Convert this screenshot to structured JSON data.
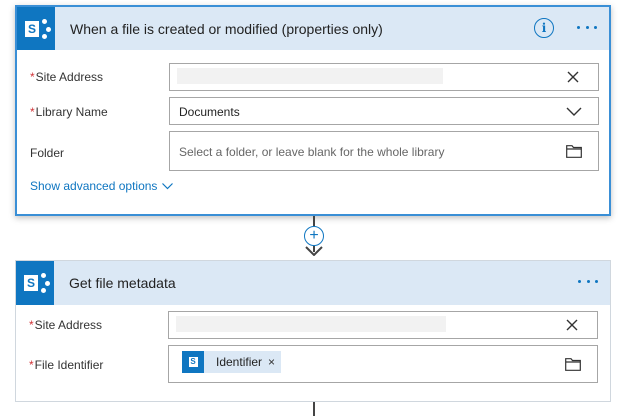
{
  "trigger": {
    "title": "When a file is created or modified (properties only)",
    "logo_letter": "S",
    "info_glyph": "i",
    "fields": {
      "site_address": {
        "label": "Site Address",
        "required": "*"
      },
      "library_name": {
        "label": "Library Name",
        "required": "*",
        "value": "Documents"
      },
      "folder": {
        "label": "Folder",
        "placeholder": "Select a folder, or leave blank for the whole library"
      }
    },
    "advanced_options": "Show advanced options"
  },
  "connector": {
    "plus_glyph": "+"
  },
  "action": {
    "title": "Get file metadata",
    "logo_letter": "S",
    "fields": {
      "site_address": {
        "label": "Site Address",
        "required": "*"
      },
      "file_identifier": {
        "label": "File Identifier",
        "required": "*",
        "token": {
          "label": "Identifier",
          "close": "×",
          "logo_letter": "S"
        }
      }
    }
  },
  "colors": {
    "accent": "#0f76c1",
    "header_bg": "#dbe8f5",
    "required": "#d13438",
    "selected_border": "#3a8fd6"
  }
}
